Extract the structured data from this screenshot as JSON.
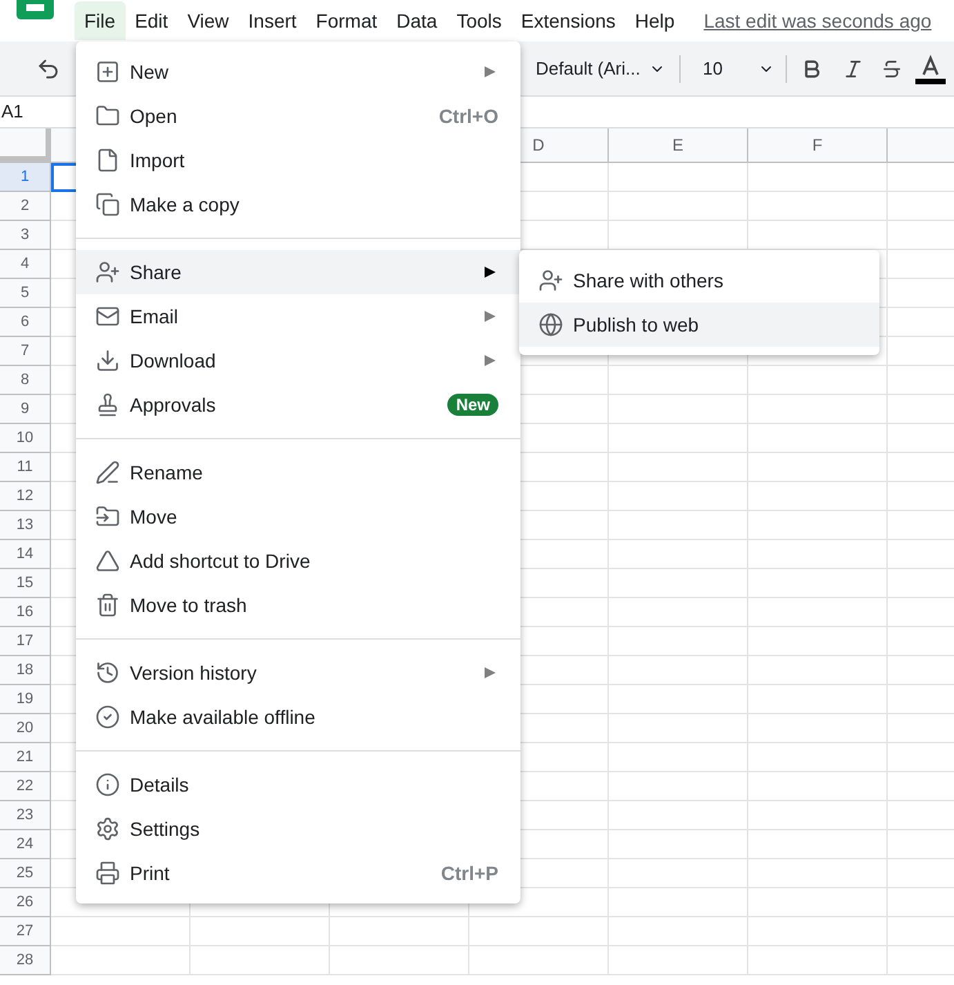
{
  "menubar": {
    "items": [
      {
        "label": "File",
        "selected": true
      },
      {
        "label": "Edit",
        "selected": false
      },
      {
        "label": "View",
        "selected": false
      },
      {
        "label": "Insert",
        "selected": false
      },
      {
        "label": "Format",
        "selected": false
      },
      {
        "label": "Data",
        "selected": false
      },
      {
        "label": "Tools",
        "selected": false
      },
      {
        "label": "Extensions",
        "selected": false
      },
      {
        "label": "Help",
        "selected": false
      }
    ],
    "last_edit": "Last edit was seconds ago"
  },
  "toolbar": {
    "font": "Default (Ari...",
    "font_size": "10"
  },
  "name_box": "A1",
  "grid": {
    "columns": [
      "D",
      "E",
      "F"
    ],
    "rows": [
      {
        "label": "1",
        "selected": true
      },
      {
        "label": "2",
        "selected": false
      },
      {
        "label": "3",
        "selected": false
      },
      {
        "label": "4",
        "selected": false
      },
      {
        "label": "5",
        "selected": false
      },
      {
        "label": "6",
        "selected": false
      },
      {
        "label": "7",
        "selected": false
      },
      {
        "label": "8",
        "selected": false
      },
      {
        "label": "9",
        "selected": false
      },
      {
        "label": "10",
        "selected": false
      },
      {
        "label": "11",
        "selected": false
      },
      {
        "label": "12",
        "selected": false
      },
      {
        "label": "13",
        "selected": false
      },
      {
        "label": "14",
        "selected": false
      },
      {
        "label": "15",
        "selected": false
      },
      {
        "label": "16",
        "selected": false
      },
      {
        "label": "17",
        "selected": false
      },
      {
        "label": "18",
        "selected": false
      },
      {
        "label": "19",
        "selected": false
      },
      {
        "label": "20",
        "selected": false
      },
      {
        "label": "21",
        "selected": false
      },
      {
        "label": "22",
        "selected": false
      },
      {
        "label": "23",
        "selected": false
      },
      {
        "label": "24",
        "selected": false
      },
      {
        "label": "25",
        "selected": false
      },
      {
        "label": "26",
        "selected": false
      },
      {
        "label": "27",
        "selected": false
      },
      {
        "label": "28",
        "selected": false
      }
    ]
  },
  "file_menu": {
    "sections": [
      [
        {
          "label": "New",
          "submenu": true,
          "highlighted": false
        },
        {
          "label": "Open",
          "shortcut": "Ctrl+O",
          "highlighted": false
        },
        {
          "label": "Import",
          "highlighted": false
        },
        {
          "label": "Make a copy",
          "highlighted": false
        }
      ],
      [
        {
          "label": "Share",
          "submenu": true,
          "highlighted": true
        },
        {
          "label": "Email",
          "submenu": true,
          "highlighted": false
        },
        {
          "label": "Download",
          "submenu": true,
          "highlighted": false
        },
        {
          "label": "Approvals",
          "badge": "New",
          "highlighted": false
        }
      ],
      [
        {
          "label": "Rename",
          "highlighted": false
        },
        {
          "label": "Move",
          "highlighted": false
        },
        {
          "label": "Add shortcut to Drive",
          "highlighted": false
        },
        {
          "label": "Move to trash",
          "highlighted": false
        }
      ],
      [
        {
          "label": "Version history",
          "submenu": true,
          "highlighted": false
        },
        {
          "label": "Make available offline",
          "highlighted": false
        }
      ],
      [
        {
          "label": "Details",
          "highlighted": false
        },
        {
          "label": "Settings",
          "highlighted": false
        },
        {
          "label": "Print",
          "shortcut": "Ctrl+P",
          "highlighted": false
        }
      ]
    ]
  },
  "share_submenu": {
    "items": [
      {
        "label": "Share with others",
        "highlighted": false
      },
      {
        "label": "Publish to web",
        "highlighted": true
      }
    ]
  }
}
